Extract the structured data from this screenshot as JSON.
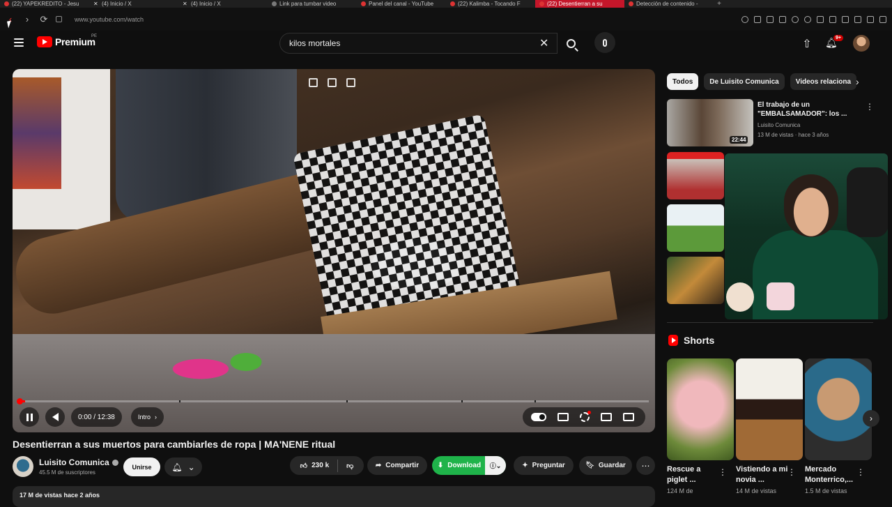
{
  "browser": {
    "tabs": [
      {
        "label": "(22) YAPEKREDITO - Jesu",
        "active": false,
        "icon": "youtube-icon"
      },
      {
        "label": "(4) Inicio / X",
        "active": false,
        "icon": "x-icon"
      },
      {
        "label": "(4) Inicio / X",
        "active": false,
        "icon": "x-icon"
      },
      {
        "label": "Link para tumbar video",
        "active": false,
        "icon": "page-icon"
      },
      {
        "label": "Panel del canal - YouTube",
        "active": false,
        "icon": "youtube-icon"
      },
      {
        "label": "(22) Kalimba - Tocando F",
        "active": false,
        "icon": "youtube-icon"
      },
      {
        "label": "(22) Desentierran a su",
        "active": true,
        "icon": "youtube-icon"
      },
      {
        "label": "Detección de contenido -",
        "active": false,
        "icon": "youtube-icon"
      }
    ],
    "new_tab": "+",
    "url": "www.youtube.com/watch"
  },
  "header": {
    "logo_text": "Premium",
    "region": "PE",
    "search_value": "kilos mortales",
    "notifications_badge": "9+"
  },
  "player": {
    "time": "0:00 / 12:38",
    "chapter": "Intro",
    "progress_fraction": 0.01
  },
  "video": {
    "title": "Desentierran a sus muertos para cambiarles de ropa | MA'NENE ritual",
    "channel": "Luisito Comunica",
    "subscribers": "45.5 M de suscriptores",
    "join_label": "Unirse",
    "likes": "230 k",
    "share_label": "Compartir",
    "download_label": "Download",
    "ask_label": "Preguntar",
    "save_label": "Guardar",
    "description_snippet": "17 M de vistas  hace 2 años"
  },
  "sidebar": {
    "chips": [
      "Todos",
      "De Luisito Comunica",
      "Videos relaciona"
    ],
    "recommendations": [
      {
        "title": "El trabajo de un \"EMBALSAMADOR\": los ...",
        "channel": "Luisito Comunica",
        "meta": "13 M de vistas · hace 3 años",
        "duration": "22:44"
      }
    ],
    "shorts_title": "Shorts",
    "shorts": [
      {
        "title": "Rescue a piglet ...",
        "views": "124 M de"
      },
      {
        "title": "Vistiendo a mi novia ...",
        "views": "14 M de vistas"
      },
      {
        "title": "Mercado Monterrico,...",
        "views": "1.5 M de vistas"
      }
    ]
  },
  "colors": {
    "background": "#0f0f0f",
    "brand_red": "#ff0000",
    "download_green": "#1fb34a",
    "chip_bg": "#272727"
  }
}
